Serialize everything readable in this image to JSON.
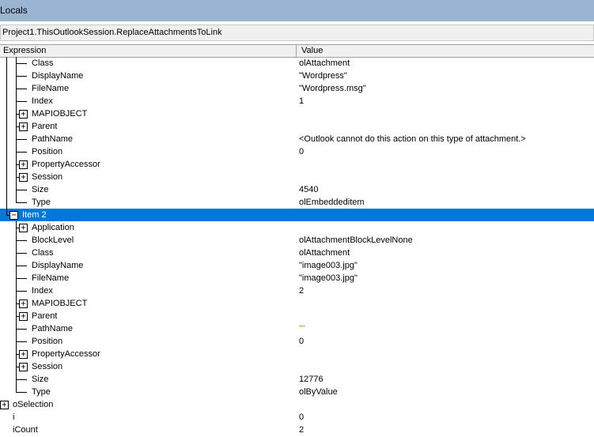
{
  "window": {
    "title": "Locals"
  },
  "context": "Project1.ThisOutlookSession.ReplaceAttachmentsToLink",
  "columns": {
    "expression": "Expression",
    "value": "Value"
  },
  "rows": [
    {
      "expr": "Class",
      "value": "olAttachment",
      "level": 2,
      "node": "leaf",
      "group": 1
    },
    {
      "expr": "DisplayName",
      "value": "\"Wordpress\"",
      "level": 2,
      "node": "leaf",
      "group": 1
    },
    {
      "expr": "FileName",
      "value": "\"Wordpress.msg\"",
      "level": 2,
      "node": "leaf",
      "group": 1
    },
    {
      "expr": "Index",
      "value": "1",
      "level": 2,
      "node": "leaf",
      "group": 1
    },
    {
      "expr": "MAPIOBJECT",
      "value": "",
      "level": 2,
      "node": "plus",
      "group": 1
    },
    {
      "expr": "Parent",
      "value": "",
      "level": 2,
      "node": "plus",
      "group": 1
    },
    {
      "expr": "PathName",
      "value": "<Outlook cannot do this action on this type of attachment.>",
      "level": 2,
      "node": "leaf",
      "group": 1
    },
    {
      "expr": "Position",
      "value": "0",
      "level": 2,
      "node": "leaf",
      "group": 1
    },
    {
      "expr": "PropertyAccessor",
      "value": "",
      "level": 2,
      "node": "plus",
      "group": 1
    },
    {
      "expr": "Session",
      "value": "",
      "level": 2,
      "node": "plus",
      "group": 1
    },
    {
      "expr": "Size",
      "value": "4540",
      "level": 2,
      "node": "leaf",
      "group": 1
    },
    {
      "expr": "Type",
      "value": "olEmbeddeditem",
      "level": 2,
      "node": "leaf",
      "group": 1,
      "last": true
    },
    {
      "expr": "Item 2",
      "value": "",
      "level": 1,
      "node": "minus",
      "selected": true,
      "last": true
    },
    {
      "expr": "Application",
      "value": "",
      "level": 2,
      "node": "plus",
      "group": 2
    },
    {
      "expr": "BlockLevel",
      "value": "olAttachmentBlockLevelNone",
      "level": 2,
      "node": "leaf",
      "group": 2
    },
    {
      "expr": "Class",
      "value": "olAttachment",
      "level": 2,
      "node": "leaf",
      "group": 2
    },
    {
      "expr": "DisplayName",
      "value": "\"image003.jpg\"",
      "level": 2,
      "node": "leaf",
      "group": 2
    },
    {
      "expr": "FileName",
      "value": "\"image003.jpg\"",
      "level": 2,
      "node": "leaf",
      "group": 2
    },
    {
      "expr": "Index",
      "value": "2",
      "level": 2,
      "node": "leaf",
      "group": 2
    },
    {
      "expr": "MAPIOBJECT",
      "value": "",
      "level": 2,
      "node": "plus",
      "group": 2
    },
    {
      "expr": "Parent",
      "value": "",
      "level": 2,
      "node": "plus",
      "group": 2
    },
    {
      "expr": "PathName",
      "value": "\"\"",
      "level": 2,
      "node": "leaf",
      "group": 2,
      "valueColor": "#d08000"
    },
    {
      "expr": "Position",
      "value": "0",
      "level": 2,
      "node": "leaf",
      "group": 2
    },
    {
      "expr": "PropertyAccessor",
      "value": "",
      "level": 2,
      "node": "plus",
      "group": 2
    },
    {
      "expr": "Session",
      "value": "",
      "level": 2,
      "node": "plus",
      "group": 2
    },
    {
      "expr": "Size",
      "value": "12776",
      "level": 2,
      "node": "leaf",
      "group": 2
    },
    {
      "expr": "Type",
      "value": "olByValue",
      "level": 2,
      "node": "leaf",
      "group": 2,
      "last": true
    },
    {
      "expr": "oSelection",
      "value": "",
      "level": 0,
      "node": "plus"
    },
    {
      "expr": "i",
      "value": "0",
      "level": 0,
      "node": "none"
    },
    {
      "expr": "iCount",
      "value": "2",
      "level": 0,
      "node": "none"
    }
  ]
}
